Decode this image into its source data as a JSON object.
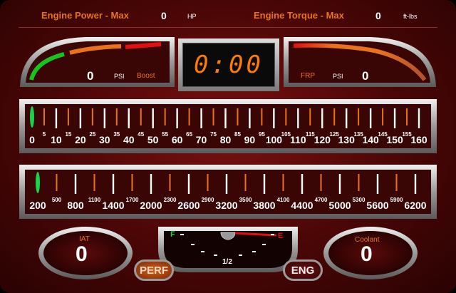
{
  "header": {
    "power_label": "Engine Power - Max",
    "power_value": "0",
    "power_unit": "HP",
    "torque_label": "Engine Torque - Max",
    "torque_value": "0",
    "torque_unit": "ft-lbs"
  },
  "boost_gauge": {
    "value": "0",
    "unit": "PSI",
    "label": "Boost"
  },
  "timer": {
    "display": "0:00"
  },
  "frp_gauge": {
    "label": "FRP",
    "unit": "PSI",
    "value": "0"
  },
  "speedometer": {
    "major_labels": [
      "0",
      "10",
      "20",
      "30",
      "40",
      "50",
      "60",
      "70",
      "80",
      "90",
      "100",
      "110",
      "120",
      "130",
      "140",
      "150",
      "160"
    ],
    "minor_labels": [
      "5",
      "15",
      "25",
      "35",
      "45",
      "55",
      "65",
      "75",
      "85",
      "95",
      "105",
      "115",
      "125",
      "135",
      "145",
      "155"
    ],
    "needle_value": 0
  },
  "tachometer": {
    "major_labels": [
      "200",
      "800",
      "1400",
      "2000",
      "2600",
      "3200",
      "3800",
      "4400",
      "5000",
      "5600",
      "6200"
    ],
    "minor_labels": [
      "500",
      "1100",
      "1700",
      "2300",
      "2900",
      "3500",
      "4100",
      "4700",
      "5300",
      "5900"
    ],
    "needle_value": 200
  },
  "iat": {
    "label": "IAT",
    "value": "0"
  },
  "coolant": {
    "label": "Coolant",
    "value": "0"
  },
  "fuel": {
    "full_label": "F",
    "empty_label": "E",
    "half_label": "1/2",
    "level": 0.0
  },
  "buttons": {
    "perf_label": "PERF",
    "eng_label": "ENG"
  },
  "colors": {
    "accent_orange": "#e8731a",
    "needle_green": "#19d24a",
    "digit_orange": "#ff7a00",
    "panel_dark": "#3a0505"
  }
}
